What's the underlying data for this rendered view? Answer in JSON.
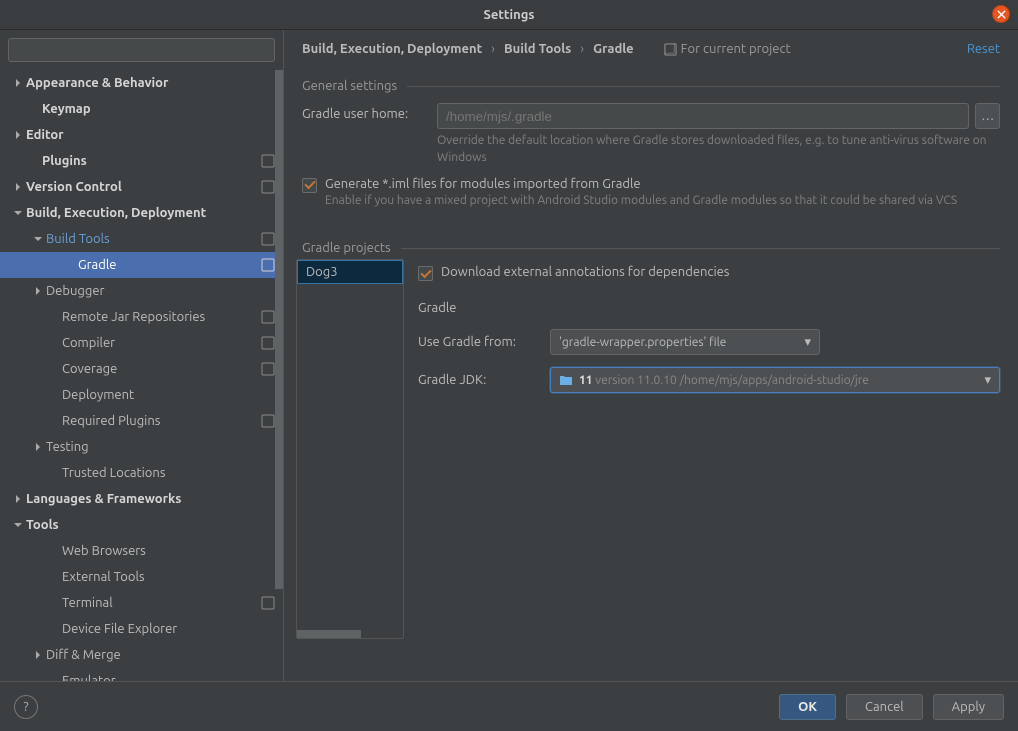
{
  "window": {
    "title": "Settings"
  },
  "search": {
    "placeholder": ""
  },
  "sidebar": {
    "items": [
      {
        "label": "Appearance & Behavior",
        "indent": 10,
        "arrow": "right",
        "bold": true
      },
      {
        "label": "Keymap",
        "indent": 26,
        "bold": true
      },
      {
        "label": "Editor",
        "indent": 10,
        "arrow": "right",
        "bold": true
      },
      {
        "label": "Plugins",
        "indent": 26,
        "bold": true,
        "badge": true
      },
      {
        "label": "Version Control",
        "indent": 10,
        "arrow": "right",
        "bold": true,
        "badge": true
      },
      {
        "label": "Build, Execution, Deployment",
        "indent": 10,
        "arrow": "down",
        "bold": true
      },
      {
        "label": "Build Tools",
        "indent": 30,
        "arrow": "down",
        "blue": true,
        "badge": true
      },
      {
        "label": "Gradle",
        "indent": 62,
        "selected": true,
        "badge": true
      },
      {
        "label": "Debugger",
        "indent": 30,
        "arrow": "right"
      },
      {
        "label": "Remote Jar Repositories",
        "indent": 46,
        "badge": true
      },
      {
        "label": "Compiler",
        "indent": 46,
        "badge": true
      },
      {
        "label": "Coverage",
        "indent": 46,
        "badge": true
      },
      {
        "label": "Deployment",
        "indent": 46
      },
      {
        "label": "Required Plugins",
        "indent": 46,
        "badge": true
      },
      {
        "label": "Testing",
        "indent": 30,
        "arrow": "right"
      },
      {
        "label": "Trusted Locations",
        "indent": 46
      },
      {
        "label": "Languages & Frameworks",
        "indent": 10,
        "arrow": "right",
        "bold": true
      },
      {
        "label": "Tools",
        "indent": 10,
        "arrow": "down",
        "bold": true
      },
      {
        "label": "Web Browsers",
        "indent": 46
      },
      {
        "label": "External Tools",
        "indent": 46
      },
      {
        "label": "Terminal",
        "indent": 46,
        "badge": true
      },
      {
        "label": "Device File Explorer",
        "indent": 46
      },
      {
        "label": "Diff & Merge",
        "indent": 30,
        "arrow": "right"
      },
      {
        "label": "Emulator",
        "indent": 46
      }
    ]
  },
  "breadcrumb": {
    "c1": "Build, Execution, Deployment",
    "c2": "Build Tools",
    "c3": "Gradle",
    "for_project": "For current project",
    "reset": "Reset"
  },
  "general": {
    "title": "General settings",
    "user_home_label": "Gradle user home:",
    "user_home_value": "/home/mjs/.gradle",
    "user_home_hint": "Override the default location where Gradle stores downloaded files, e.g. to tune anti-virus software on Windows",
    "iml_label": "Generate *.iml files for modules imported from Gradle",
    "iml_hint": "Enable if you have a mixed project with Android Studio modules and Gradle modules so that it could be shared via VCS"
  },
  "projects": {
    "title": "Gradle projects",
    "list": [
      "Dog3"
    ],
    "download_label": "Download external annotations for dependencies",
    "gradle_header": "Gradle",
    "use_from_label": "Use Gradle from:",
    "use_from_value": "'gradle-wrapper.properties' file",
    "jdk_label": "Gradle JDK:",
    "jdk_num": "11",
    "jdk_rest": "version 11.0.10 /home/mjs/apps/android-studio/jre"
  },
  "buttons": {
    "ok": "OK",
    "cancel": "Cancel",
    "apply": "Apply"
  }
}
